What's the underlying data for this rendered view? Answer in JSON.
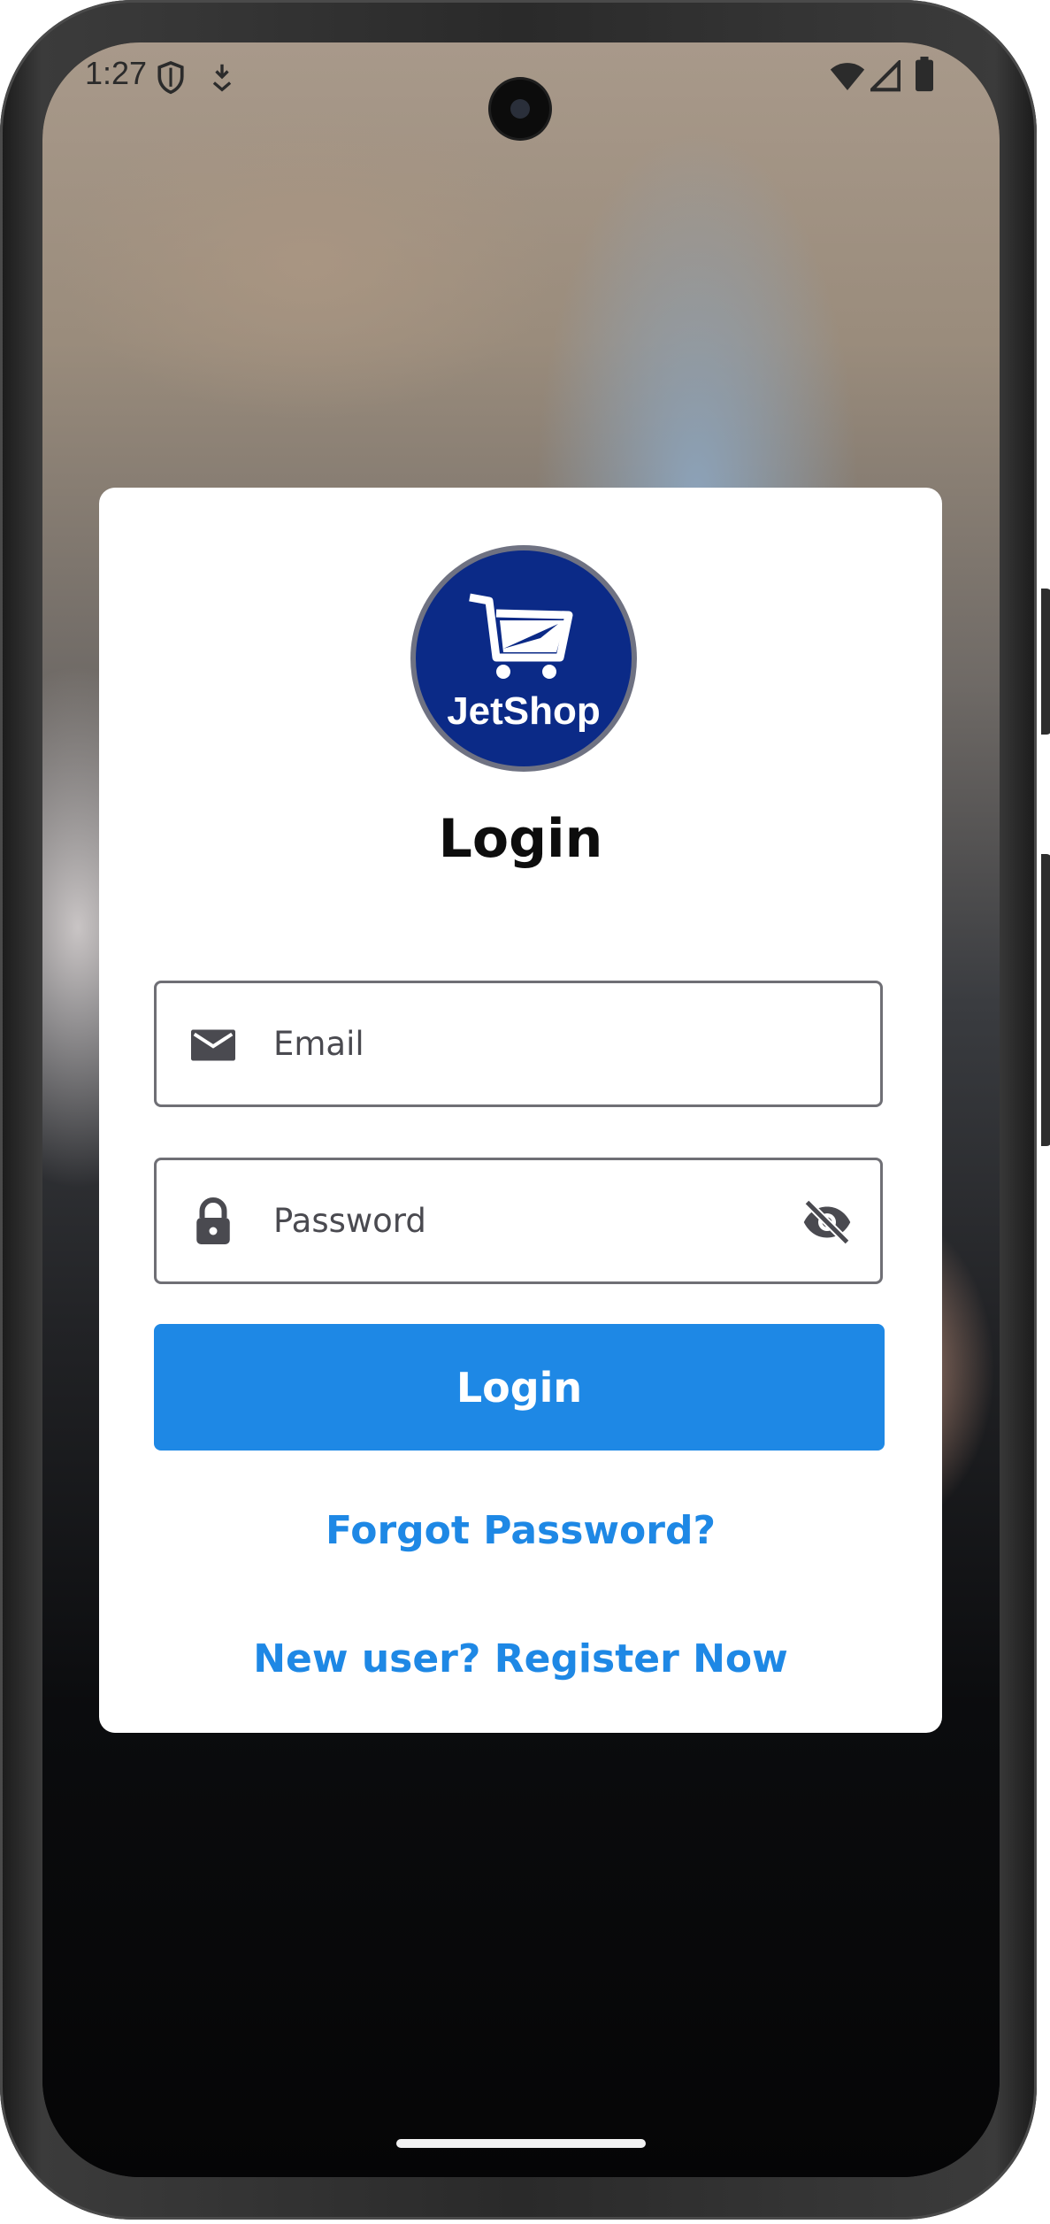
{
  "status_bar": {
    "time": "1:27"
  },
  "logo": {
    "text": "JetShop",
    "colors": {
      "circle": "#0b2a87",
      "ring": "#6f7282",
      "text": "#ffffff"
    }
  },
  "login_card": {
    "title": "Login",
    "email_placeholder": "Email",
    "password_placeholder": "Password",
    "login_button": "Login",
    "forgot_password": "Forgot Password?",
    "register_link": "New user? Register Now"
  },
  "colors": {
    "accent": "#1e88e5",
    "card_background": "#ffffff",
    "icon": "#4a4a50"
  },
  "icons": {
    "email": "mail-icon",
    "password": "lock-icon",
    "visibility": "eye-off-icon"
  }
}
